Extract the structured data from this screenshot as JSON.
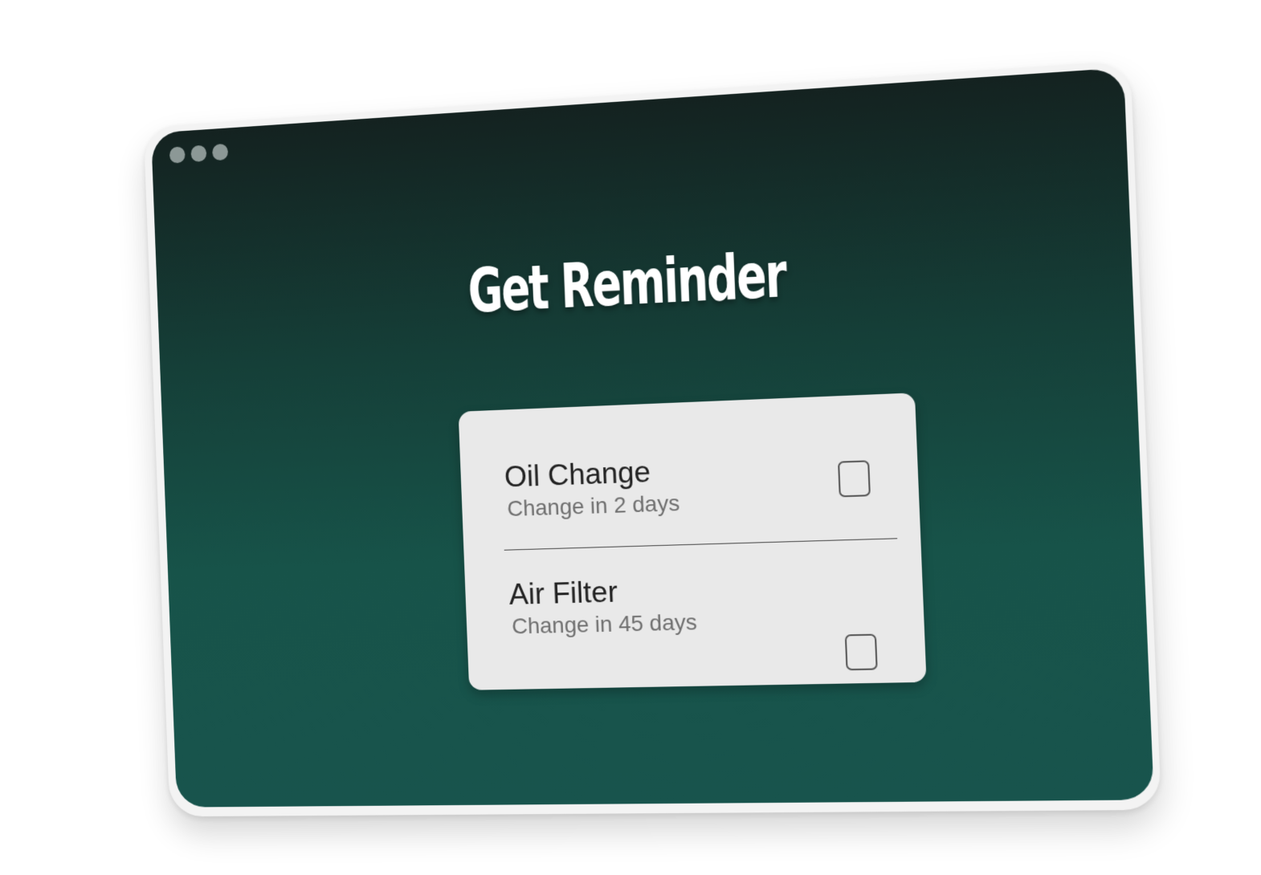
{
  "window": {
    "controls": [
      "dot",
      "dot",
      "dot"
    ]
  },
  "page": {
    "title": "Get Reminder"
  },
  "reminders": [
    {
      "title": "Oil Change",
      "subtitle": "Change in 2 days",
      "checked": false
    },
    {
      "title": "Air Filter",
      "subtitle": "Change in 45 days",
      "checked": false
    }
  ],
  "colors": {
    "background_top": "#142220",
    "background_bottom": "#18544d",
    "card": "#e9e9e9",
    "title": "#ffffff"
  }
}
